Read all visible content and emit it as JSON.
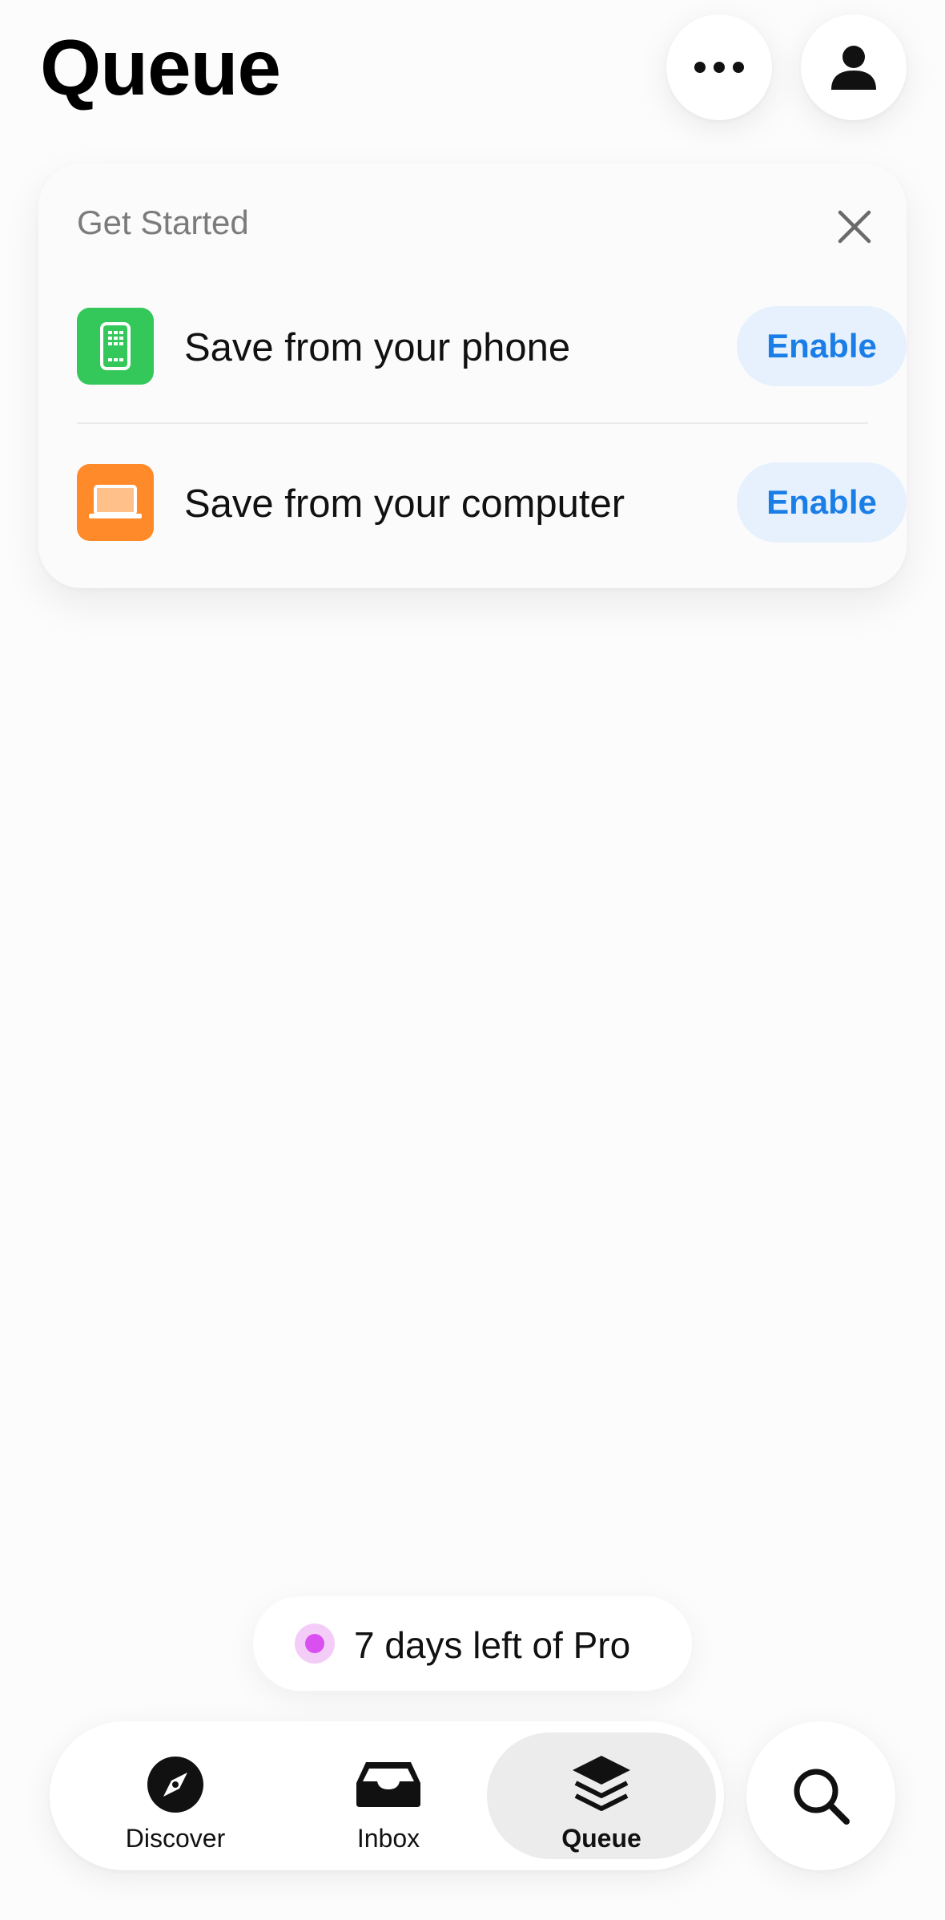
{
  "header": {
    "title": "Queue",
    "more_icon": "ellipsis-icon",
    "profile_icon": "person-icon"
  },
  "get_started": {
    "title": "Get Started",
    "close_icon": "close-icon",
    "items": [
      {
        "label": "Save from your phone",
        "icon": "phone-icon",
        "icon_color": "#34c759",
        "button": "Enable"
      },
      {
        "label": "Save from your computer",
        "icon": "laptop-icon",
        "icon_color": "#ff8a2a",
        "button": "Enable"
      }
    ]
  },
  "pro_banner": {
    "text": "7 days left of Pro",
    "dot_color": "#d94ff0"
  },
  "tabbar": {
    "tabs": [
      {
        "label": "Discover",
        "icon": "compass-icon",
        "active": false
      },
      {
        "label": "Inbox",
        "icon": "inbox-tray-icon",
        "active": false
      },
      {
        "label": "Queue",
        "icon": "stack-layers-icon",
        "active": true
      }
    ],
    "search_icon": "search-icon"
  },
  "colors": {
    "accent": "#1a7ee6",
    "enable_bg": "#e6f1fd"
  }
}
